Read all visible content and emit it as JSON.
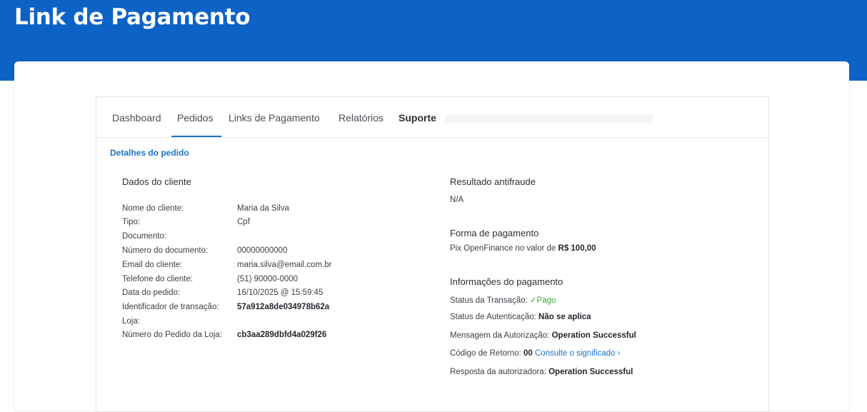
{
  "header": {
    "title": "Link de Pagamento"
  },
  "tabs": [
    {
      "label": "Dashboard"
    },
    {
      "label": "Pedidos"
    },
    {
      "label": "Links de Pagamento"
    },
    {
      "label": "Relatórios"
    },
    {
      "label": "Suporte"
    }
  ],
  "active_tab": "Pedidos",
  "section_title": "Detalhes do pedido",
  "cliente": {
    "title": "Dados do cliente",
    "rows": [
      {
        "label": "Nome do cliente:",
        "value": "Maria da Silva"
      },
      {
        "label": "Tipo:",
        "value": "Cpf"
      },
      {
        "label": "Documento:",
        "value": ""
      },
      {
        "label": "Número do documento:",
        "value": "00000000000"
      },
      {
        "label": "Email do cliente:",
        "value": "maria.silva@email.com.br"
      },
      {
        "label": "Telefone do cliente:",
        "value": "(51) 90000-0000"
      },
      {
        "label": "Data do pedido:",
        "value": "16/10/2025 @ 15:59:45"
      },
      {
        "label": "Identificador de transação:",
        "value": "57a912a8de034978b62a"
      },
      {
        "label": "Loja:",
        "value": ""
      },
      {
        "label": "Número do Pedido da Loja:",
        "value": "cb3aa289dbfd4a029f26"
      }
    ]
  },
  "antifraude": {
    "title": "Resultado antifraude",
    "value": "N/A"
  },
  "forma_pagamento": {
    "title": "Forma de pagamento",
    "text": "Pix OpenFinance no valor de",
    "amount": "R$ 100,00"
  },
  "info_pagamento": {
    "title": "Informações do pagamento",
    "status_label": "Status da Transação:",
    "status_icon": "✓",
    "status_value": "Pago",
    "auth_label": "Status de Autenticação:",
    "auth_value": "Não se aplica",
    "msg_label": "Mensagem da Autorização:",
    "msg_value": "Operation Successful",
    "code_label": "Código de Retorno:",
    "code_value": "00",
    "code_link": "Consulte o significado",
    "code_link_icon": "›",
    "resp_label": "Resposta da autorizadora:",
    "resp_value": "Operation Successful"
  },
  "colors": {
    "brand": "#0d62c6",
    "link": "#1a73c9",
    "success": "#3aa63a"
  }
}
